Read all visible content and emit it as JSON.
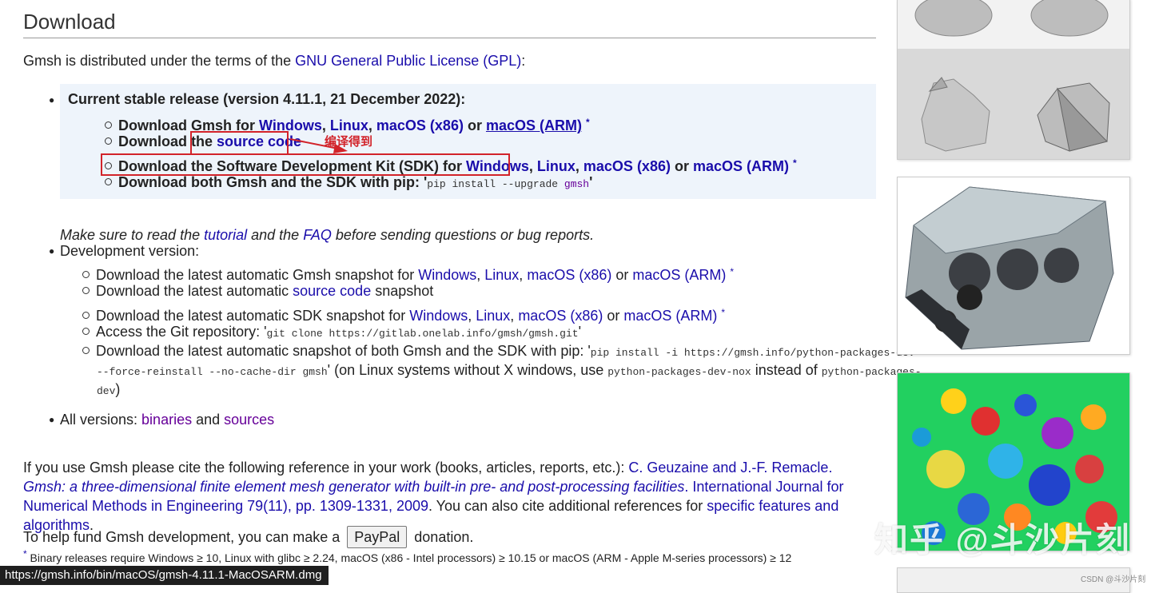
{
  "title": "Download",
  "license": {
    "prefix": "Gmsh is distributed under the terms of the ",
    "link": "GNU General Public License (GPL)",
    "suffix": ":"
  },
  "stable": {
    "heading": "Current stable release (version 4.11.1, 21 December 2022):",
    "row1": {
      "prefix": "Download Gmsh for ",
      "windows": "Windows",
      ",": ",",
      "linux": "Linux",
      "macx86": "macOS (x86)",
      "or": " or ",
      "macarm": "macOS (ARM)",
      "star": "*"
    },
    "row2": {
      "prefix": "Download the ",
      "link": "source code"
    },
    "row3": {
      "prefix": "Download the Software Development Kit (SDK) for ",
      "windows": "Windows",
      "linux": "Linux",
      "macx86": "macOS (x86)",
      "or": " or ",
      "macarm": "macOS (ARM)",
      "star": "*"
    },
    "row4": {
      "prefix": "Download both Gmsh and the SDK with pip: '",
      "pip": "pip install --upgrade ",
      "gmsh": "gmsh",
      "suffix": "'"
    }
  },
  "annotation": "编译得到",
  "note": {
    "a": "Make sure to read the ",
    "tutorial": "tutorial",
    "b": " and the ",
    "faq": "FAQ",
    "c": " before sending questions or bug reports."
  },
  "dev": {
    "heading": "Development version:",
    "row1": {
      "prefix": "Download the latest automatic Gmsh snapshot for ",
      "windows": "Windows",
      "linux": "Linux",
      "macx86": "macOS (x86)",
      "or": " or ",
      "macarm": "macOS (ARM)",
      "star": "*"
    },
    "row2": {
      "prefix": "Download the latest automatic ",
      "link": "source code",
      "suffix": " snapshot"
    },
    "row3": {
      "prefix": "Download the latest automatic SDK snapshot for ",
      "windows": "Windows",
      "linux": "Linux",
      "macx86": "macOS (x86)",
      "or": " or ",
      "macarm": "macOS (ARM)",
      "star": "*"
    },
    "row4": {
      "prefix": "Access the Git repository: '",
      "code": "git clone https://gitlab.onelab.info/gmsh/gmsh.git",
      "suffix": "'"
    },
    "row5": {
      "prefix": "Download the latest automatic snapshot of both Gmsh and the SDK with pip: '",
      "code": "pip install -i https://gmsh.info/python-packages-dev"
    },
    "row6": {
      "code": "--force-reinstall --no-cache-dir gmsh",
      "mid": "' (on Linux systems without X windows, use ",
      "code2": "python-packages-dev-nox",
      "tail": " instead of ",
      "code3": "python-packages-"
    },
    "row7": {
      "code": "dev",
      "suffix": ")"
    }
  },
  "allversions": {
    "prefix": "All versions: ",
    "binaries": "binaries",
    "and": " and ",
    "sources": "sources"
  },
  "cite": {
    "a": "If you use Gmsh please cite the following reference in your work (books, articles, reports, etc.): ",
    "authors": "C. Geuzaine and J.-F. Remacle. ",
    "paper": "Gmsh: a three-dimensional finite element mesh generator with built-in pre- and post-processing facilities",
    "journal": ". International Journal for Numerical Methods in Engineering 79(11), pp. 1309-1331, 2009",
    "b": ". You can also cite additional references for ",
    "specific": "specific features and algorithms",
    "c": "."
  },
  "fund": {
    "a": "To help fund Gmsh development, you can make a ",
    "paypal": "PayPal",
    "b": " donation."
  },
  "footnote": {
    "star": "*",
    "text": " Binary releases require Windows ≥ 10, Linux with glibc ≥ 2.24, macOS (x86 - Intel processors) ≥ 10.15 or macOS (ARM - Apple M-series processors) ≥ 12"
  },
  "status_url": "https://gmsh.info/bin/macOS/gmsh-4.11.1-MacOSARM.dmg",
  "watermark": "知乎 @斗沙片刻",
  "csdn": "CSDN @斗沙片刻",
  "colors": {
    "link": "#1a0dab",
    "visited": "#660099",
    "annotation": "#d2232a",
    "box": "#eef4fb"
  }
}
